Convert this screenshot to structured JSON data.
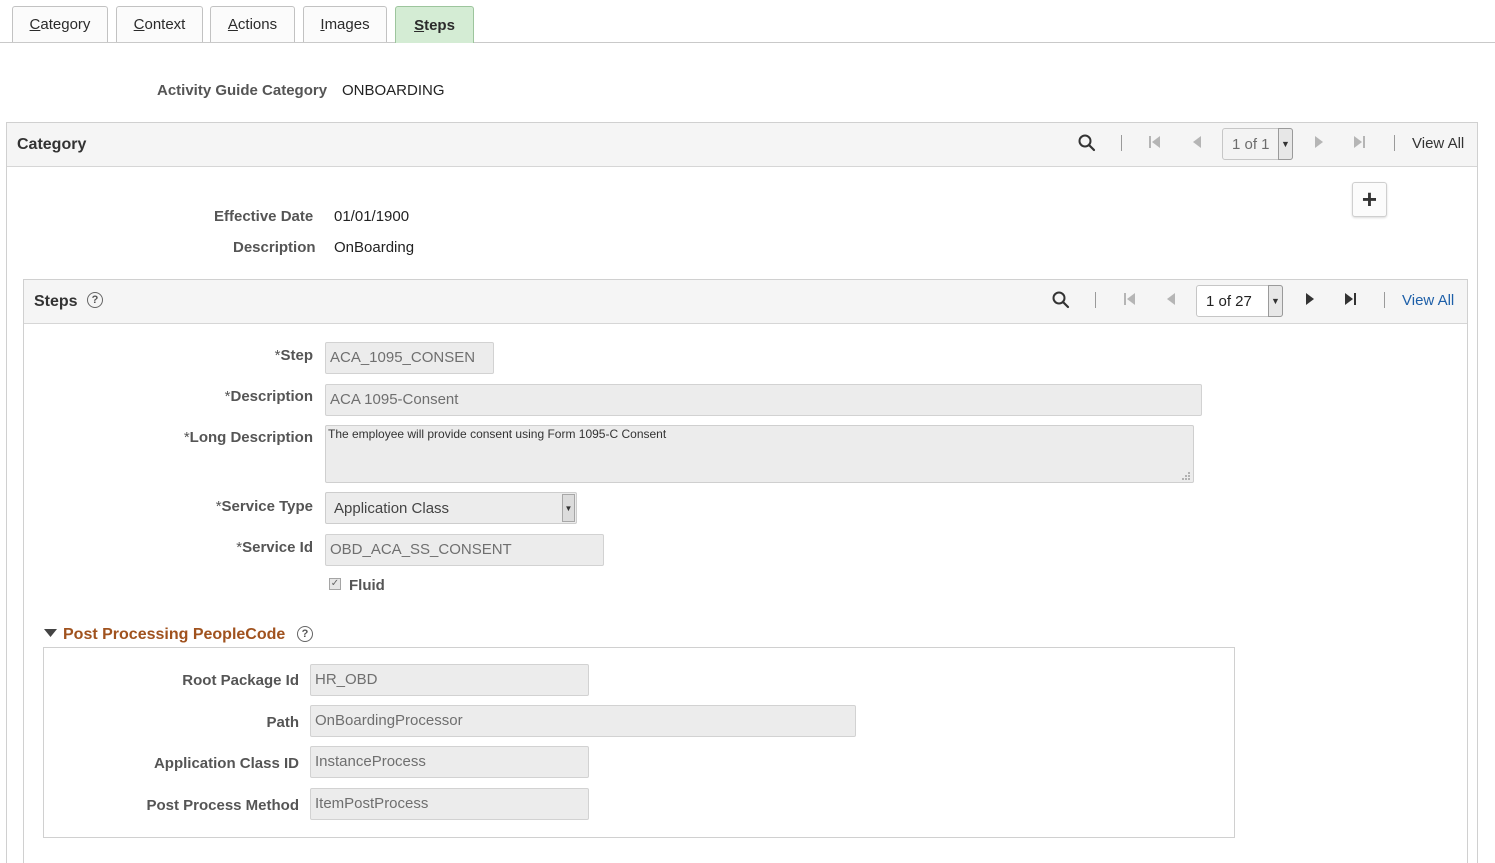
{
  "tabs": [
    {
      "label": "Category"
    },
    {
      "label": "Context"
    },
    {
      "label": "Actions"
    },
    {
      "label": "Images"
    },
    {
      "label": "Steps"
    }
  ],
  "header": {
    "category_label": "Activity Guide Category",
    "category_value": "ONBOARDING"
  },
  "category_grid": {
    "title": "Category",
    "pager": "1 of 1",
    "view_all": "View All",
    "effective_date_label": "Effective Date",
    "effective_date_value": "01/01/1900",
    "description_label": "Description",
    "description_value": "OnBoarding",
    "add_button": "+"
  },
  "steps_grid": {
    "title": "Steps",
    "pager": "1 of 27",
    "view_all": "View All",
    "step": {
      "label": "Step",
      "value": "ACA_1095_CONSEN"
    },
    "description": {
      "label": "Description",
      "value": "ACA 1095-Consent"
    },
    "long_description": {
      "label": "Long Description",
      "value": "The employee will provide consent using Form 1095-C Consent"
    },
    "service_type": {
      "label": "Service Type",
      "value": "Application Class"
    },
    "service_id": {
      "label": "Service Id",
      "value": "OBD_ACA_SS_CONSENT"
    },
    "fluid": {
      "label": "Fluid",
      "checked": true
    }
  },
  "post_processing": {
    "title": "Post Processing PeopleCode",
    "root_package": {
      "label": "Root Package Id",
      "value": "HR_OBD"
    },
    "path": {
      "label": "Path",
      "value": "OnBoardingProcessor"
    },
    "app_class_id": {
      "label": "Application Class ID",
      "value": "InstanceProcess"
    },
    "post_method": {
      "label": "Post Process Method",
      "value": "ItemPostProcess"
    }
  },
  "colors": {
    "active_tab": "#d4ecd4",
    "section_title": "#a0521e",
    "link": "#1d5fa8"
  },
  "required_marker": "*",
  "icons": {
    "search": "search-icon",
    "first": "first-page-icon",
    "prev": "previous-page-icon",
    "next": "next-page-icon",
    "last": "last-page-icon",
    "help": "help-icon",
    "collapse": "collapse-triangle-icon"
  }
}
